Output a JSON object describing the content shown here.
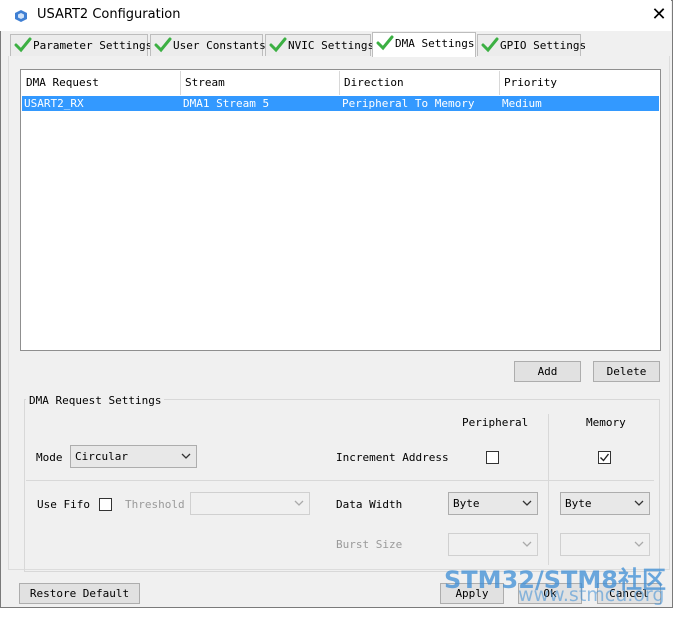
{
  "window": {
    "title": "USART2 Configuration",
    "close_glyph": "✕"
  },
  "tabs": [
    {
      "label": "Parameter Settings",
      "icon": "check-icon"
    },
    {
      "label": "User Constants",
      "icon": "check-icon"
    },
    {
      "label": "NVIC Settings",
      "icon": "check-icon"
    },
    {
      "label": "DMA Settings",
      "icon": "check-icon",
      "active": true
    },
    {
      "label": "GPIO Settings",
      "icon": "check-icon"
    }
  ],
  "dma_table": {
    "columns": [
      "DMA Request",
      "Stream",
      "Direction",
      "Priority"
    ],
    "rows": [
      {
        "request": "USART2_RX",
        "stream": "DMA1 Stream 5",
        "direction": "Peripheral To Memory",
        "priority": "Medium",
        "selected": true
      }
    ]
  },
  "table_buttons": {
    "add": "Add",
    "delete": "Delete"
  },
  "settings": {
    "group_title": "DMA Request Settings",
    "peripheral_header": "Peripheral",
    "memory_header": "Memory",
    "mode_label": "Mode",
    "mode_value": "Circular",
    "increment_address_label": "Increment Address",
    "peripheral_increment": false,
    "memory_increment": true,
    "use_fifo_label": "Use Fifo",
    "use_fifo": false,
    "threshold_label": "Threshold",
    "threshold_value": "",
    "data_width_label": "Data Width",
    "peripheral_data_width": "Byte",
    "memory_data_width": "Byte",
    "burst_size_label": "Burst Size",
    "peripheral_burst": "",
    "memory_burst": ""
  },
  "footer": {
    "restore": "Restore Default",
    "apply": "Apply",
    "ok": "Ok",
    "cancel": "Cancel"
  },
  "watermark": {
    "line1": "STM32/STM8社区",
    "line2": "www.stmcu.org"
  },
  "colors": {
    "selection": "#3399ff",
    "check": "#3cb043",
    "accent": "#1e6e9a"
  }
}
